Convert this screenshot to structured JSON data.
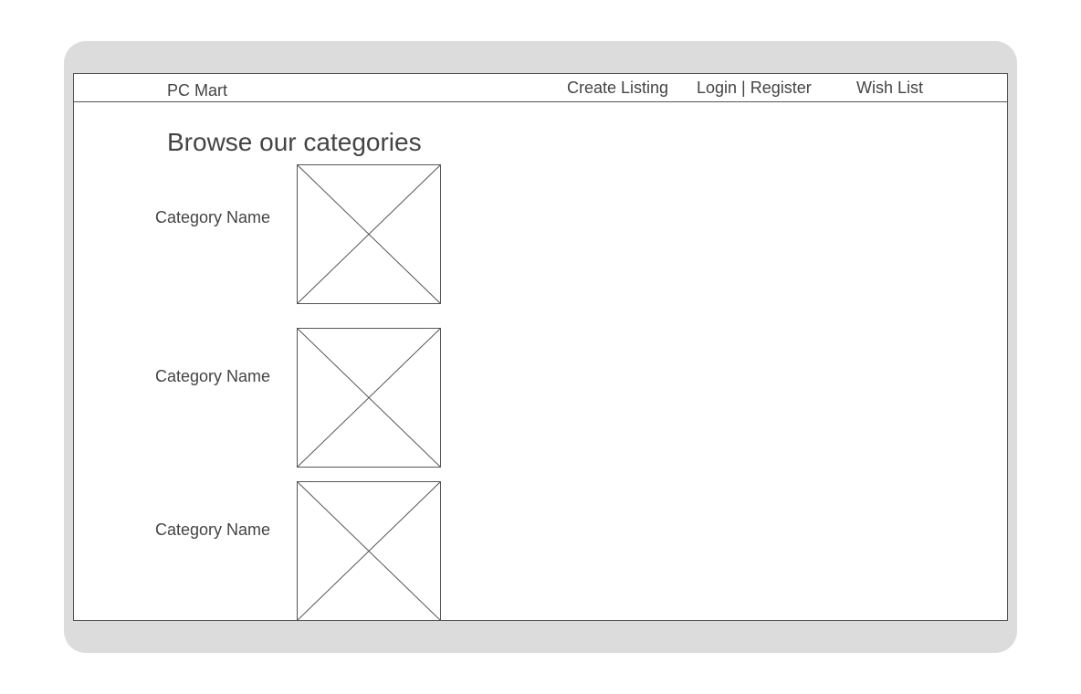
{
  "header": {
    "brand": "PC Mart",
    "nav": {
      "create_listing": "Create Listing",
      "login_register": "Login | Register",
      "wish_list": "Wish List"
    }
  },
  "main": {
    "title": "Browse our categories",
    "categories": [
      {
        "label": "Category Name",
        "image": "placeholder-image"
      },
      {
        "label": "Category Name",
        "image": "placeholder-image"
      },
      {
        "label": "Category Name",
        "image": "placeholder-image"
      }
    ]
  },
  "colors": {
    "frame": "#dcdcdc",
    "border": "#555555",
    "text": "#444444"
  }
}
